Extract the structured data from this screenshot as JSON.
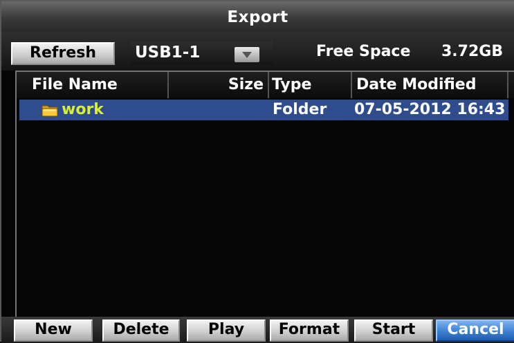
{
  "window": {
    "title": "Export"
  },
  "toolbar": {
    "refresh_label": "Refresh",
    "device_selected": "USB1-1",
    "free_space_label": "Free Space",
    "free_space_value": "3.72GB"
  },
  "file_list": {
    "columns": [
      "File Name",
      "Size",
      "Type",
      "Date Modified"
    ],
    "rows": [
      {
        "icon": "folder-icon",
        "name": "work",
        "size": "",
        "type": "Folder",
        "date_modified": "07-05-2012 16:43"
      }
    ]
  },
  "buttons": {
    "new": "New",
    "delete": "Delete",
    "play": "Play",
    "format": "Format",
    "start": "Start",
    "cancel": "Cancel"
  },
  "colors": {
    "selected_row": "#2f4d8c",
    "folder_name_text": "#d9ee36",
    "active_button": "#3e7fd0"
  }
}
